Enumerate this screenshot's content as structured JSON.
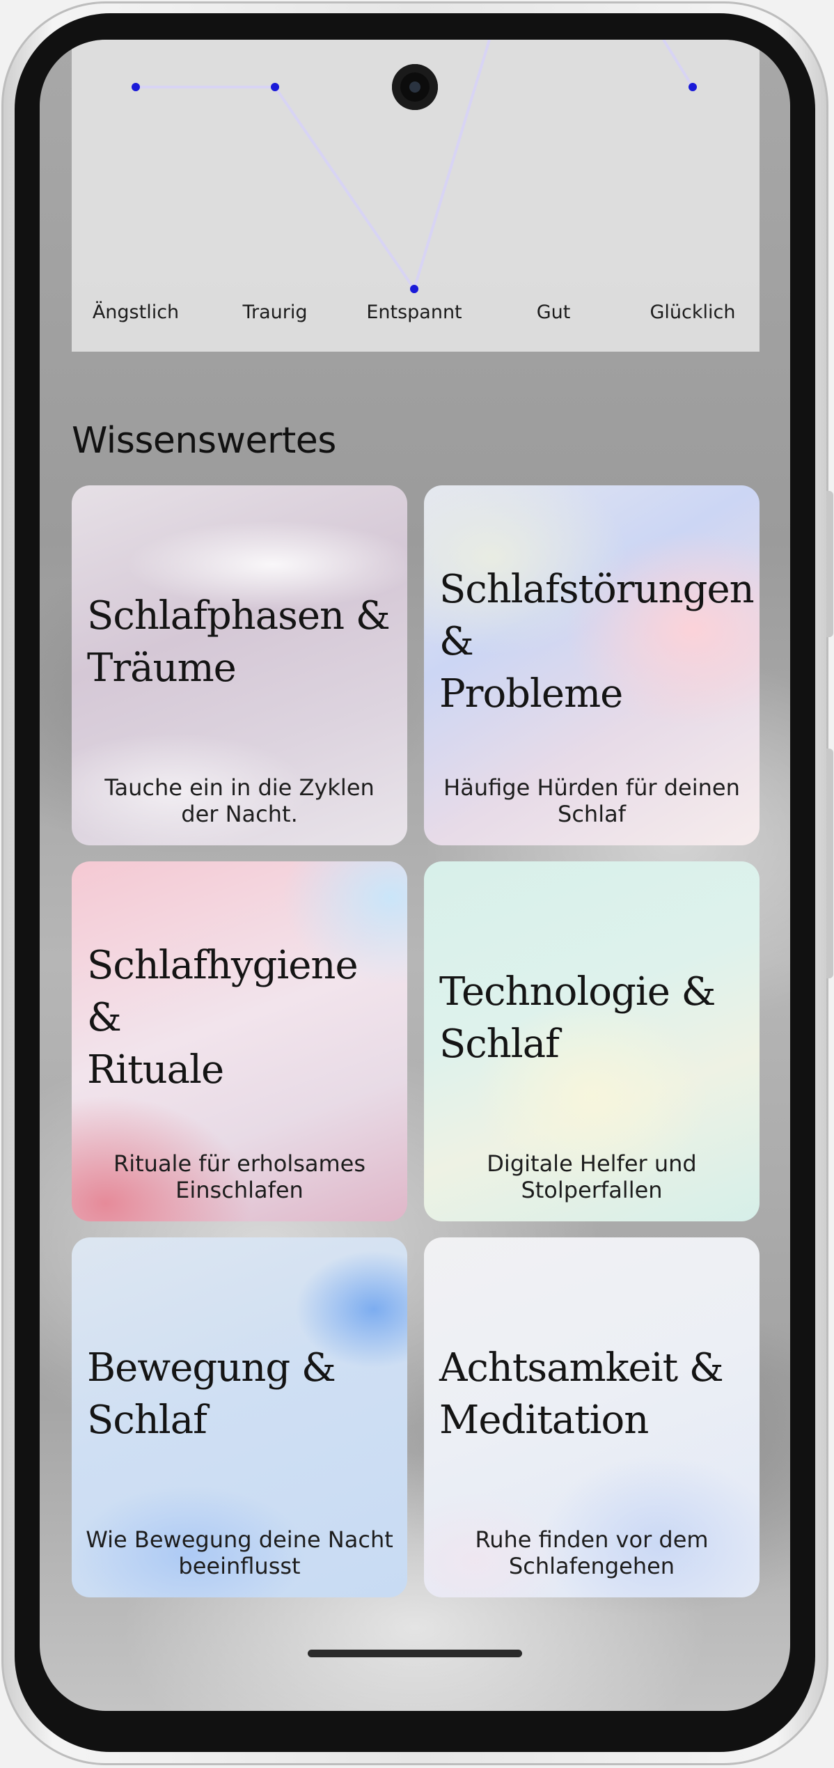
{
  "mood_chart": {
    "labels": [
      "Ängstlich",
      "Traurig",
      "Entspannt",
      "Gut",
      "Glücklich"
    ],
    "line_color": "#d8d4f4",
    "point_color": "#1a1ad8"
  },
  "knowledge": {
    "title": "Wissenswertes",
    "cards": [
      {
        "title": "Schlafphasen &\nTräume",
        "subtitle": "Tauche ein in die Zyklen der Nacht."
      },
      {
        "title": "Schlafstörungen\n&\nProbleme",
        "subtitle": "Häufige Hürden für deinen Schlaf"
      },
      {
        "title": "Schlafhygiene\n&\nRituale",
        "subtitle": "Rituale für erholsames Einschlafen"
      },
      {
        "title": "Technologie &\nSchlaf",
        "subtitle": "Digitale Helfer und Stolperfallen"
      },
      {
        "title": "Bewegung &\nSchlaf",
        "subtitle": "Wie Bewegung deine Nacht beeinflusst"
      },
      {
        "title": "Achtsamkeit &\nMeditation",
        "subtitle": "Ruhe finden vor dem Schlafengehen"
      }
    ]
  }
}
